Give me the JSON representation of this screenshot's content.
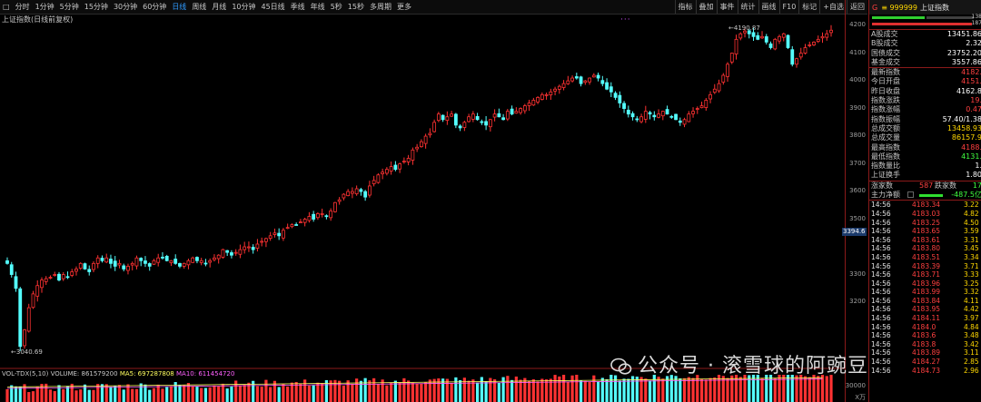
{
  "toolbar": {
    "left_icon": "□",
    "periods": [
      "分时",
      "1分钟",
      "5分钟",
      "15分钟",
      "30分钟",
      "60分钟",
      "日线",
      "周线",
      "月线",
      "10分钟",
      "45日线",
      "季线",
      "年线",
      "5秒",
      "15秒",
      "多周期",
      "更多"
    ],
    "active_period": "日线",
    "right_buttons": [
      "指标",
      "叠加",
      "事件",
      "统计",
      "画线",
      "F10",
      "标记",
      "+自选",
      "返回"
    ]
  },
  "chart_title": "上证指数(日线前复权)",
  "chart_dots": "···",
  "price_axis": {
    "ticks": [
      "4200",
      "4100",
      "4000",
      "3900",
      "3800",
      "3700",
      "3600",
      "3500",
      "3300",
      "3200"
    ],
    "cursor_value": "3394.6"
  },
  "annotations": {
    "high": "4190.87",
    "low": "3040.69"
  },
  "volume": {
    "label_main": "VOL-TDX(5,10)",
    "volume_text": "VOLUME: 861579200",
    "ma5_text": "MA5: 697287808",
    "ma10_text": "MA10: 611454720",
    "axis_ticks": [
      "30000",
      "X万"
    ]
  },
  "chart_data": {
    "type": "candlestick",
    "title": "上证指数(日线前复权)",
    "ylim": [
      3000,
      4220
    ],
    "high_label": 4190.87,
    "low_label": 3040.69,
    "closes": [
      3340,
      3300,
      3250,
      3040,
      3100,
      3180,
      3230,
      3260,
      3280,
      3285,
      3290,
      3300,
      3280,
      3300,
      3290,
      3310,
      3320,
      3340,
      3320,
      3310,
      3340,
      3360,
      3350,
      3360,
      3340,
      3330,
      3340,
      3320,
      3330,
      3340,
      3360,
      3350,
      3340,
      3330,
      3350,
      3360,
      3360,
      3350,
      3350,
      3340,
      3330,
      3340,
      3350,
      3360,
      3350,
      3350,
      3340,
      3350,
      3360,
      3370,
      3390,
      3380,
      3370,
      3380,
      3390,
      3400,
      3400,
      3390,
      3410,
      3420,
      3430,
      3440,
      3450,
      3440,
      3460,
      3470,
      3480,
      3480,
      3490,
      3500,
      3510,
      3500,
      3520,
      3520,
      3510,
      3530,
      3560,
      3570,
      3590,
      3600,
      3600,
      3610,
      3600,
      3580,
      3620,
      3640,
      3660,
      3670,
      3680,
      3690,
      3680,
      3700,
      3710,
      3720,
      3750,
      3760,
      3780,
      3800,
      3810,
      3850,
      3880,
      3860,
      3870,
      3880,
      3840,
      3830,
      3850,
      3870,
      3880,
      3860,
      3850,
      3840,
      3860,
      3880,
      3870,
      3860,
      3890,
      3880,
      3890,
      3900,
      3910,
      3920,
      3930,
      3940,
      3950,
      3950,
      3960,
      3970,
      3980,
      3990,
      4000,
      4010,
      4010,
      3990,
      4000,
      4010,
      4020,
      4010,
      3990,
      3970,
      3960,
      3940,
      3920,
      3900,
      3880,
      3870,
      3860,
      3870,
      3890,
      3880,
      3870,
      3880,
      3890,
      3880,
      3870,
      3860,
      3850,
      3860,
      3880,
      3890,
      3900,
      3910,
      3930,
      3950,
      3970,
      3990,
      4020,
      4060,
      4100,
      4150,
      4170,
      4180,
      4170,
      4160,
      4150,
      4160,
      4140,
      4120,
      4150,
      4160,
      4170,
      4120,
      4060,
      4080,
      4100,
      4120,
      4130,
      4140,
      4150,
      4160,
      4170,
      4183
    ],
    "volume_ma5": 697287808,
    "volume_ma10": 611454720,
    "volume_last": 861579200
  },
  "panel": {
    "header": {
      "marker": "G",
      "code": "≡ 999999",
      "name": "上证指数"
    },
    "bar_values": [
      "138",
      "187"
    ],
    "stats_group1": [
      {
        "label": "A股成交",
        "value": "13451.86",
        "color": "white"
      },
      {
        "label": "B股成交",
        "value": "2.32",
        "color": "white"
      },
      {
        "label": "国债成交",
        "value": "23752.20",
        "color": "white"
      },
      {
        "label": "基金成交",
        "value": "3557.86",
        "color": "white"
      }
    ],
    "stats_group2": [
      {
        "label": "最新指数",
        "value": "4182.",
        "color": "red"
      },
      {
        "label": "今日开盘",
        "value": "4151.",
        "color": "red"
      },
      {
        "label": "昨日收盘",
        "value": "4162.8",
        "color": "white"
      },
      {
        "label": "指数涨跌",
        "value": "19.",
        "color": "red"
      },
      {
        "label": "指数涨幅",
        "value": "0.47",
        "color": "red"
      },
      {
        "label": "指数振幅",
        "value": "57.40/1.38",
        "color": "white"
      },
      {
        "label": "总成交额",
        "value": "13458.93",
        "color": "yellow"
      },
      {
        "label": "总成交量",
        "value": "86157.9",
        "color": "yellow"
      },
      {
        "label": "最高指数",
        "value": "4188.",
        "color": "red"
      },
      {
        "label": "最低指数",
        "value": "4131.",
        "color": "green"
      },
      {
        "label": "指数量比",
        "value": "1.",
        "color": "white"
      },
      {
        "label": "上证换手",
        "value": "1.80",
        "color": "white"
      }
    ],
    "breadth": {
      "up_label": "涨家数",
      "up_value": "587",
      "down_label": "跌家数",
      "down_value": "17"
    },
    "main_flow": {
      "label": "主力净额",
      "value": "-487.5亿"
    },
    "ticks": [
      {
        "t": "14:56",
        "p": "4183.34",
        "v": "3.22"
      },
      {
        "t": "14:56",
        "p": "4183.03",
        "v": "4.82"
      },
      {
        "t": "14:56",
        "p": "4183.25",
        "v": "4.50"
      },
      {
        "t": "14:56",
        "p": "4183.65",
        "v": "3.59"
      },
      {
        "t": "14:56",
        "p": "4183.61",
        "v": "3.31"
      },
      {
        "t": "14:56",
        "p": "4183.80",
        "v": "3.45"
      },
      {
        "t": "14:56",
        "p": "4183.51",
        "v": "3.34"
      },
      {
        "t": "14:56",
        "p": "4183.39",
        "v": "3.71"
      },
      {
        "t": "14:56",
        "p": "4183.71",
        "v": "3.33"
      },
      {
        "t": "14:56",
        "p": "4183.96",
        "v": "3.25"
      },
      {
        "t": "14:56",
        "p": "4183.99",
        "v": "3.32"
      },
      {
        "t": "14:56",
        "p": "4183.84",
        "v": "4.11"
      },
      {
        "t": "14:56",
        "p": "4183.95",
        "v": "4.42"
      },
      {
        "t": "14:56",
        "p": "4184.11",
        "v": "3.97"
      },
      {
        "t": "14:56",
        "p": "4184.0",
        "v": "4.84"
      },
      {
        "t": "14:56",
        "p": "4183.6",
        "v": "3.48"
      },
      {
        "t": "14:56",
        "p": "4183.8",
        "v": "3.42"
      },
      {
        "t": "14:56",
        "p": "4183.89",
        "v": "3.11"
      },
      {
        "t": "14:56",
        "p": "4184.27",
        "v": "2.85"
      },
      {
        "t": "14:56",
        "p": "4184.73",
        "v": "2.96"
      }
    ]
  },
  "watermark": "公众号 · 滚雪球的阿豌豆"
}
